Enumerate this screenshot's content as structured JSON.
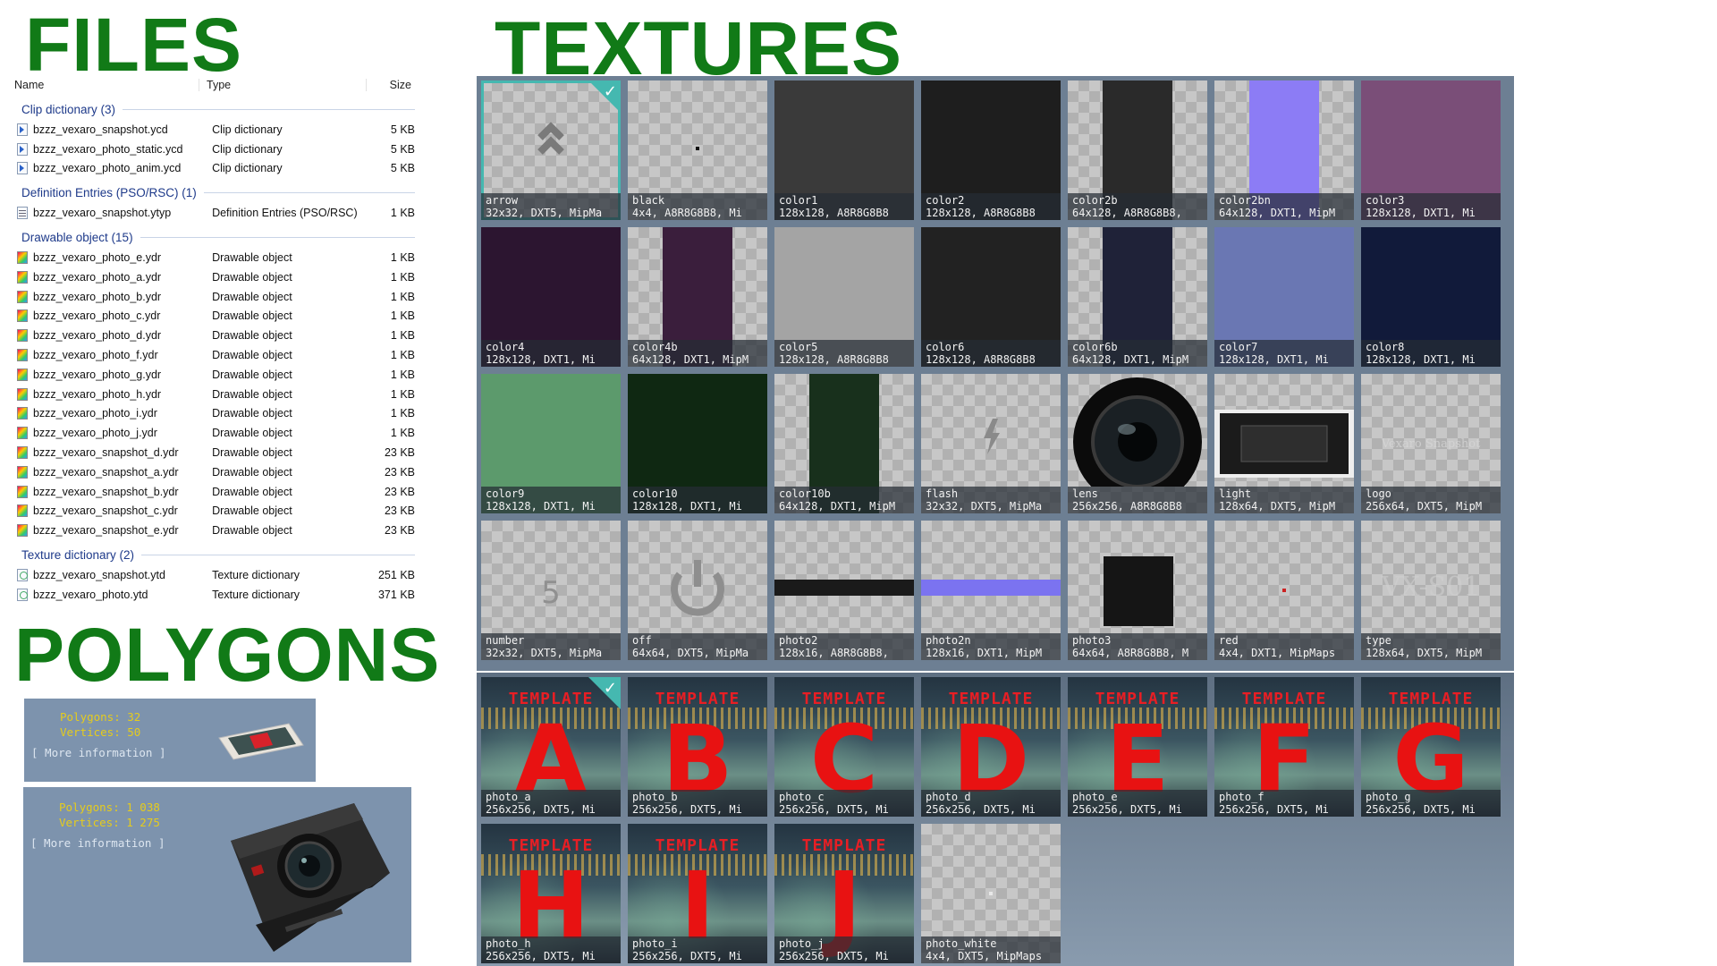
{
  "titles": {
    "files": "FILES",
    "textures": "TEXTURES",
    "polygons": "POLYGONS"
  },
  "explorer": {
    "columns": {
      "name": "Name",
      "type": "Type",
      "size": "Size"
    },
    "groups": [
      {
        "header": "Clip dictionary (3)",
        "files": [
          {
            "name": "bzzz_vexaro_snapshot.ycd",
            "type": "Clip dictionary",
            "size": "5 KB",
            "icon": "clip-file-icon"
          },
          {
            "name": "bzzz_vexaro_photo_static.ycd",
            "type": "Clip dictionary",
            "size": "5 KB",
            "icon": "clip-file-icon"
          },
          {
            "name": "bzzz_vexaro_photo_anim.ycd",
            "type": "Clip dictionary",
            "size": "5 KB",
            "icon": "clip-file-icon"
          }
        ]
      },
      {
        "header": "Definition Entries (PSO/RSC) (1)",
        "files": [
          {
            "name": "bzzz_vexaro_snapshot.ytyp",
            "type": "Definition Entries (PSO/RSC)",
            "size": "1 KB",
            "icon": "definition-file-icon"
          }
        ]
      },
      {
        "header": "Drawable object (15)",
        "files": [
          {
            "name": "bzzz_vexaro_photo_e.ydr",
            "type": "Drawable object",
            "size": "1 KB",
            "icon": "drawable-file-icon"
          },
          {
            "name": "bzzz_vexaro_photo_a.ydr",
            "type": "Drawable object",
            "size": "1 KB",
            "icon": "drawable-file-icon"
          },
          {
            "name": "bzzz_vexaro_photo_b.ydr",
            "type": "Drawable object",
            "size": "1 KB",
            "icon": "drawable-file-icon"
          },
          {
            "name": "bzzz_vexaro_photo_c.ydr",
            "type": "Drawable object",
            "size": "1 KB",
            "icon": "drawable-file-icon"
          },
          {
            "name": "bzzz_vexaro_photo_d.ydr",
            "type": "Drawable object",
            "size": "1 KB",
            "icon": "drawable-file-icon"
          },
          {
            "name": "bzzz_vexaro_photo_f.ydr",
            "type": "Drawable object",
            "size": "1 KB",
            "icon": "drawable-file-icon"
          },
          {
            "name": "bzzz_vexaro_photo_g.ydr",
            "type": "Drawable object",
            "size": "1 KB",
            "icon": "drawable-file-icon"
          },
          {
            "name": "bzzz_vexaro_photo_h.ydr",
            "type": "Drawable object",
            "size": "1 KB",
            "icon": "drawable-file-icon"
          },
          {
            "name": "bzzz_vexaro_photo_i.ydr",
            "type": "Drawable object",
            "size": "1 KB",
            "icon": "drawable-file-icon"
          },
          {
            "name": "bzzz_vexaro_photo_j.ydr",
            "type": "Drawable object",
            "size": "1 KB",
            "icon": "drawable-file-icon"
          },
          {
            "name": "bzzz_vexaro_snapshot_d.ydr",
            "type": "Drawable object",
            "size": "23 KB",
            "icon": "drawable-file-icon"
          },
          {
            "name": "bzzz_vexaro_snapshot_a.ydr",
            "type": "Drawable object",
            "size": "23 KB",
            "icon": "drawable-file-icon"
          },
          {
            "name": "bzzz_vexaro_snapshot_b.ydr",
            "type": "Drawable object",
            "size": "23 KB",
            "icon": "drawable-file-icon"
          },
          {
            "name": "bzzz_vexaro_snapshot_c.ydr",
            "type": "Drawable object",
            "size": "23 KB",
            "icon": "drawable-file-icon"
          },
          {
            "name": "bzzz_vexaro_snapshot_e.ydr",
            "type": "Drawable object",
            "size": "23 KB",
            "icon": "drawable-file-icon"
          }
        ]
      },
      {
        "header": "Texture dictionary (2)",
        "files": [
          {
            "name": "bzzz_vexaro_snapshot.ytd",
            "type": "Texture dictionary",
            "size": "251 KB",
            "icon": "texture-file-icon"
          },
          {
            "name": "bzzz_vexaro_photo.ytd",
            "type": "Texture dictionary",
            "size": "371 KB",
            "icon": "texture-file-icon"
          }
        ]
      }
    ]
  },
  "polygons": [
    {
      "polygons": "Polygons: 32",
      "vertices": "Vertices: 50",
      "more": "[ More information ]",
      "preview": "photo-card-preview"
    },
    {
      "polygons": "Polygons: 1 038",
      "vertices": "Vertices: 1 275",
      "more": "[ More information ]",
      "preview": "camera-model-preview"
    }
  ],
  "textures": [
    {
      "name": "arrow",
      "info": "32x32, DXT5, MipMa",
      "color": "",
      "selected": true,
      "kind": "arrow"
    },
    {
      "name": "black",
      "info": "4x4, A8R8G8B8, Mi",
      "color": "",
      "kind": "dot"
    },
    {
      "name": "color1",
      "info": "128x128, A8R8G8B8",
      "color": "#3a3a3a"
    },
    {
      "name": "color2",
      "info": "128x128, A8R8G8B8",
      "color": "#1e1e1e"
    },
    {
      "name": "color2b",
      "info": "64x128, A8R8G8B8,",
      "color": "#2a2a2a",
      "half": true
    },
    {
      "name": "color2bn",
      "info": "64x128, DXT1, MipM",
      "color": "#8c7cf5",
      "half": true
    },
    {
      "name": "color3",
      "info": "128x128, DXT1, Mi",
      "color": "#7a4e78"
    },
    {
      "name": "color4",
      "info": "128x128, DXT1, Mi",
      "color": "#2c1530"
    },
    {
      "name": "color4b",
      "info": "64x128, DXT1, MipM",
      "color": "#3a1e3c",
      "half": true
    },
    {
      "name": "color5",
      "info": "128x128, A8R8G8B8",
      "color": "#a4a4a4"
    },
    {
      "name": "color6",
      "info": "128x128, A8R8G8B8",
      "color": "#222222"
    },
    {
      "name": "color6b",
      "info": "64x128, DXT1, MipM",
      "color": "#1f2238",
      "half": true
    },
    {
      "name": "color7",
      "info": "128x128, DXT1, Mi",
      "color": "#6a77b3"
    },
    {
      "name": "color8",
      "info": "128x128, DXT1, Mi",
      "color": "#111a3a"
    },
    {
      "name": "color9",
      "info": "128x128, DXT1, Mi",
      "color": "#5c9a6c"
    },
    {
      "name": "color10",
      "info": "128x128, DXT1, Mi",
      "color": "#0f2812"
    },
    {
      "name": "color10b",
      "info": "64x128, DXT1, MipM",
      "color": "#18301c",
      "half": true
    },
    {
      "name": "flash",
      "info": "32x32, DXT5, MipMa",
      "color": "",
      "kind": "flash"
    },
    {
      "name": "lens",
      "info": "256x256, A8R8G8B8",
      "color": "",
      "kind": "lens"
    },
    {
      "name": "light",
      "info": "128x64, DXT5, MipM",
      "color": "",
      "kind": "light"
    },
    {
      "name": "logo",
      "info": "256x64, DXT5, MipM",
      "color": "",
      "kind": "logo"
    },
    {
      "name": "number",
      "info": "32x32, DXT5, MipMa",
      "color": "",
      "kind": "number"
    },
    {
      "name": "off",
      "info": "64x64, DXT5, MipMa",
      "color": "",
      "kind": "power"
    },
    {
      "name": "photo2",
      "info": "128x16, A8R8G8B8,",
      "color": "#1a1a1a",
      "kind": "strip"
    },
    {
      "name": "photo2n",
      "info": "128x16, DXT1, MipM",
      "color": "#7b73f0",
      "kind": "strip"
    },
    {
      "name": "photo3",
      "info": "64x64, A8R8G8B8, M",
      "color": "#151515",
      "kind": "square"
    },
    {
      "name": "red",
      "info": "4x4, DXT1, MipMaps",
      "color": "#cc2222",
      "kind": "reddot"
    },
    {
      "name": "type",
      "info": "128x64, DXT5, MipM",
      "color": "",
      "kind": "type"
    }
  ],
  "photos": [
    {
      "name": "photo_a",
      "info": "256x256, DXT5, Mi",
      "letter": "A",
      "template": "TEMPLATE",
      "selected": true
    },
    {
      "name": "photo_b",
      "info": "256x256, DXT5, Mi",
      "letter": "B",
      "template": "TEMPLATE"
    },
    {
      "name": "photo_c",
      "info": "256x256, DXT5, Mi",
      "letter": "C",
      "template": "TEMPLATE"
    },
    {
      "name": "photo_d",
      "info": "256x256, DXT5, Mi",
      "letter": "D",
      "template": "TEMPLATE"
    },
    {
      "name": "photo_e",
      "info": "256x256, DXT5, Mi",
      "letter": "E",
      "template": "TEMPLATE"
    },
    {
      "name": "photo_f",
      "info": "256x256, DXT5, Mi",
      "letter": "F",
      "template": "TEMPLATE"
    },
    {
      "name": "photo_g",
      "info": "256x256, DXT5, Mi",
      "letter": "G",
      "template": "TEMPLATE"
    },
    {
      "name": "photo_h",
      "info": "256x256, DXT5, Mi",
      "letter": "H",
      "template": "TEMPLATE"
    },
    {
      "name": "photo_i",
      "info": "256x256, DXT5, Mi",
      "letter": "I",
      "template": "TEMPLATE"
    },
    {
      "name": "photo_j",
      "info": "256x256, DXT5, Mi",
      "letter": "J",
      "template": "TEMPLATE"
    },
    {
      "name": "photo_white",
      "info": "4x4, DXT5, MipMaps",
      "letter": "",
      "template": "",
      "kind": "white"
    }
  ],
  "colors": {
    "title_green": "#117a17",
    "selection": "#45b8b0",
    "stats_yellow": "#e6cc1c"
  }
}
